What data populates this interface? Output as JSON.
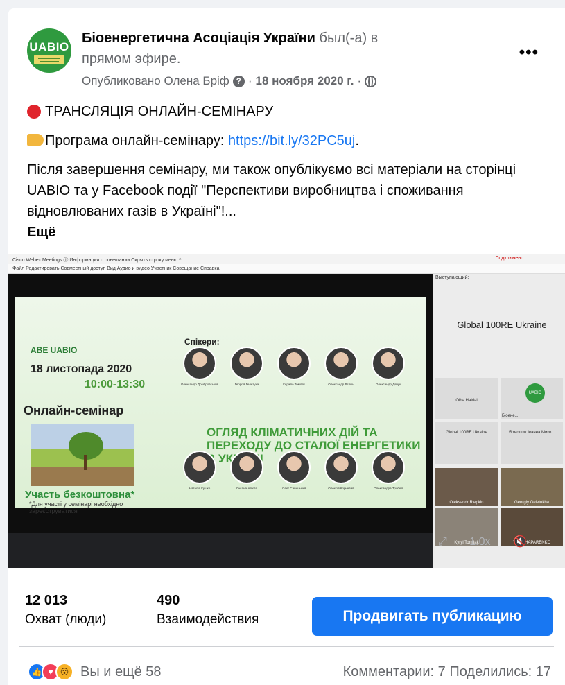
{
  "post": {
    "page_name": "Біоенергетична Асоціація України",
    "live_text": " был(-а) в",
    "live_text2": "прямом эфире.",
    "published_by": "Опубликовано Олена Бріф",
    "date": "18 ноября 2020 г.",
    "separator": "·",
    "more_options": "•••",
    "avatar_text": "UABIO"
  },
  "body": {
    "line1": "ТРАНСЛЯЦІЯ ОНЛАЙН-СЕМІНАРУ",
    "line2_prefix": "Програма онлайн-семінару: ",
    "line2_link": "https://bit.ly/32PC5uj",
    "line2_suffix": ".",
    "paragraph": "Після завершення семінару, ми також опублікуємо всі матеріали на сторінці UABIO та у Facebook події \"Перспективи виробництва і споживання відновлюваних газів в Україні\"!...",
    "see_more": "Ещё"
  },
  "video": {
    "window_title": "Cisco Webex Meetings   ⓘ Информация о совещании   Скрыть строку меню ^",
    "connected": "Подключено",
    "menu": "Файл  Редактировать  Совместный доступ  Вид  Аудио и видео  Участник  Совещание  Справка",
    "speakers_label": "Выступающий:",
    "slide": {
      "logos": "ABE UABIO",
      "date": "18 листопада 2020",
      "time": "10:00-13:30",
      "online": "Онлайн-семінар",
      "free": "Участь безкоштовна*",
      "note": "*Для участі у семінарі необхідно зареєструватися",
      "speakers_title": "Спікери:",
      "topic": "ОГЛЯД КЛІМАТИЧНИХ ДІЙ ТА ПЕРЕХОДУ ДО СТАЛОЇ ЕНЕРГЕТИКИ В УКРАЇНІ",
      "speakers_top": [
        "Олександр Домбровський",
        "Георгій Гелетуха",
        "Кирило Томляк",
        "Олександр Рєпкін",
        "Олександр Дячук"
      ],
      "speakers_bottom": [
        "Наталія Кушко",
        "Оксана Алієва",
        "Олег Савицький",
        "Олексій Корчевий",
        "Олександра Тробей"
      ]
    },
    "side": {
      "global_title": "Global 100RE Ukraine",
      "olha": "Olha Haidai",
      "bio": "Біоене...",
      "global_small": "Global 100RE Ukraine",
      "yarmosh": "Ярмошик Іванна Мико...",
      "p1": "Oleksandr Riepkin",
      "p2": "Georgiy Geletukha",
      "p3": "Kyryl Tomliak",
      "p4": "Yurii SHAPARENKO"
    },
    "speed": "1.0x"
  },
  "stats": {
    "reach_value": "12 013",
    "reach_label": "Охват (люди)",
    "engagement_value": "490",
    "engagement_label": "Взаимодействия",
    "promote_label": "Продвигать публикацию"
  },
  "footer": {
    "reactions_text": "Вы и ещё 58",
    "comments_shares": "Комментарии: 7  Поделились: 17"
  },
  "colors": {
    "accent": "#1877f2",
    "secondary_text": "#65676b",
    "live_red": "#e0242c"
  }
}
